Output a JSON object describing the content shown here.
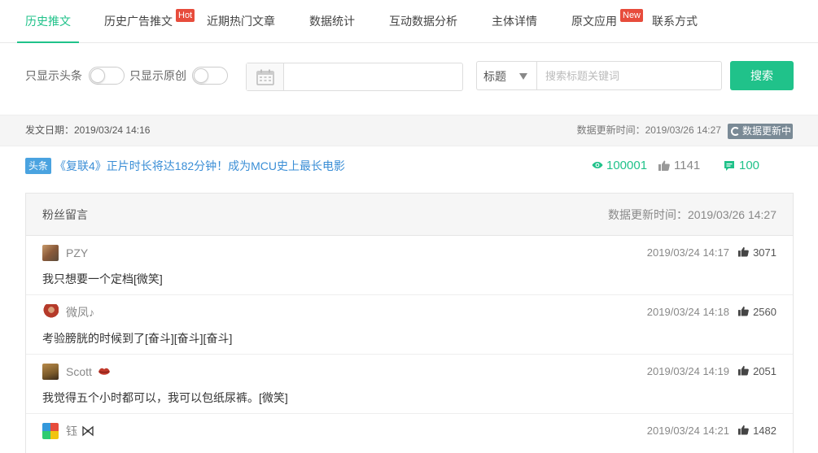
{
  "tabs": [
    {
      "label": "历史推文",
      "active": true
    },
    {
      "label": "历史广告推文",
      "badge": "Hot"
    },
    {
      "label": "近期热门文章"
    },
    {
      "label": "数据统计"
    },
    {
      "label": "互动数据分析"
    },
    {
      "label": "主体详情"
    },
    {
      "label": "原文应用",
      "badge": "New"
    },
    {
      "label": "联系方式"
    }
  ],
  "filter": {
    "only_headline_label": "只显示头条",
    "only_original_label": "只显示原创",
    "date_value": "",
    "select_value": "标题",
    "search_placeholder": "搜索标题关键词",
    "search_button": "搜索"
  },
  "info": {
    "publish_date": "发文日期：2019/03/24 14:16",
    "update_time": "数据更新时间：2019/03/26 14:27",
    "updating_label": "数据更新中"
  },
  "article": {
    "tag": "头条",
    "title": "《复联4》正片时长将达182分钟！成为MCU史上最长电影",
    "views": "100001",
    "likes": "1141",
    "comments": "100"
  },
  "comments_panel": {
    "title": "粉丝留言",
    "update_time": "数据更新时间：2019/03/26 14:27",
    "items": [
      {
        "name": "PZY",
        "time": "2019/03/24 14:17",
        "likes": "3071",
        "text": "我只想要一个定档[微笑]"
      },
      {
        "name": "微凤♪",
        "time": "2019/03/24 14:18",
        "likes": "2560",
        "text": "考验膀胱的时候到了[奋斗][奋斗][奋斗]"
      },
      {
        "name": "Scott",
        "time": "2019/03/24 14:19",
        "likes": "2051",
        "text": "我觉得五个小时都可以，我可以包纸尿裤。[微笑]"
      },
      {
        "name": "钰",
        "time": "2019/03/24 14:21",
        "likes": "1482",
        "text": ""
      }
    ]
  },
  "colors": {
    "accent": "#20c28a",
    "link": "#3a8ed6",
    "tag": "#4aa3e0",
    "badge": "#e74c3c"
  }
}
